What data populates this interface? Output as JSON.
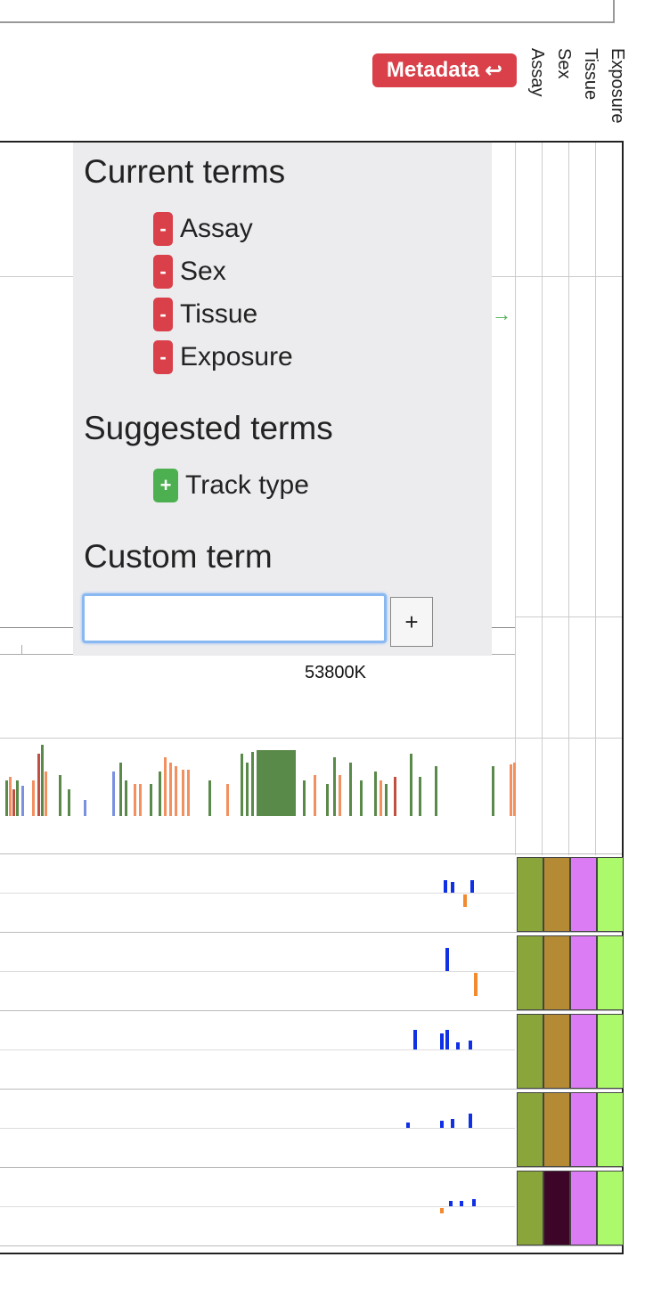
{
  "metadata_button": {
    "label": "Metadata",
    "icon": "return-arrow-icon"
  },
  "metadata_columns": [
    "Assay",
    "Sex",
    "Tissue",
    "Exposure"
  ],
  "popup": {
    "current_title": "Current terms",
    "current_terms": [
      "Assay",
      "Sex",
      "Tissue",
      "Exposure"
    ],
    "remove_symbol": "-",
    "suggested_title": "Suggested terms",
    "suggested_terms": [
      "Track type"
    ],
    "add_symbol": "+",
    "custom_title": "Custom term",
    "custom_input_value": "",
    "custom_add_label": "+"
  },
  "axis": {
    "label": "53800K"
  },
  "colors": {
    "assay": "#8aa53a",
    "sex_default": "#b48a34",
    "sex_alt": "#3d0528",
    "tissue": "#dc7cf4",
    "exposure": "#adf96c",
    "signal_pos": "#1030e6",
    "signal_neg": "#f28a30",
    "annot_green": "#5a8a4a",
    "annot_orange": "#f29060"
  },
  "track_rows": [
    {
      "sex": "default"
    },
    {
      "sex": "default"
    },
    {
      "sex": "default"
    },
    {
      "sex": "default"
    },
    {
      "sex": "alt"
    }
  ]
}
